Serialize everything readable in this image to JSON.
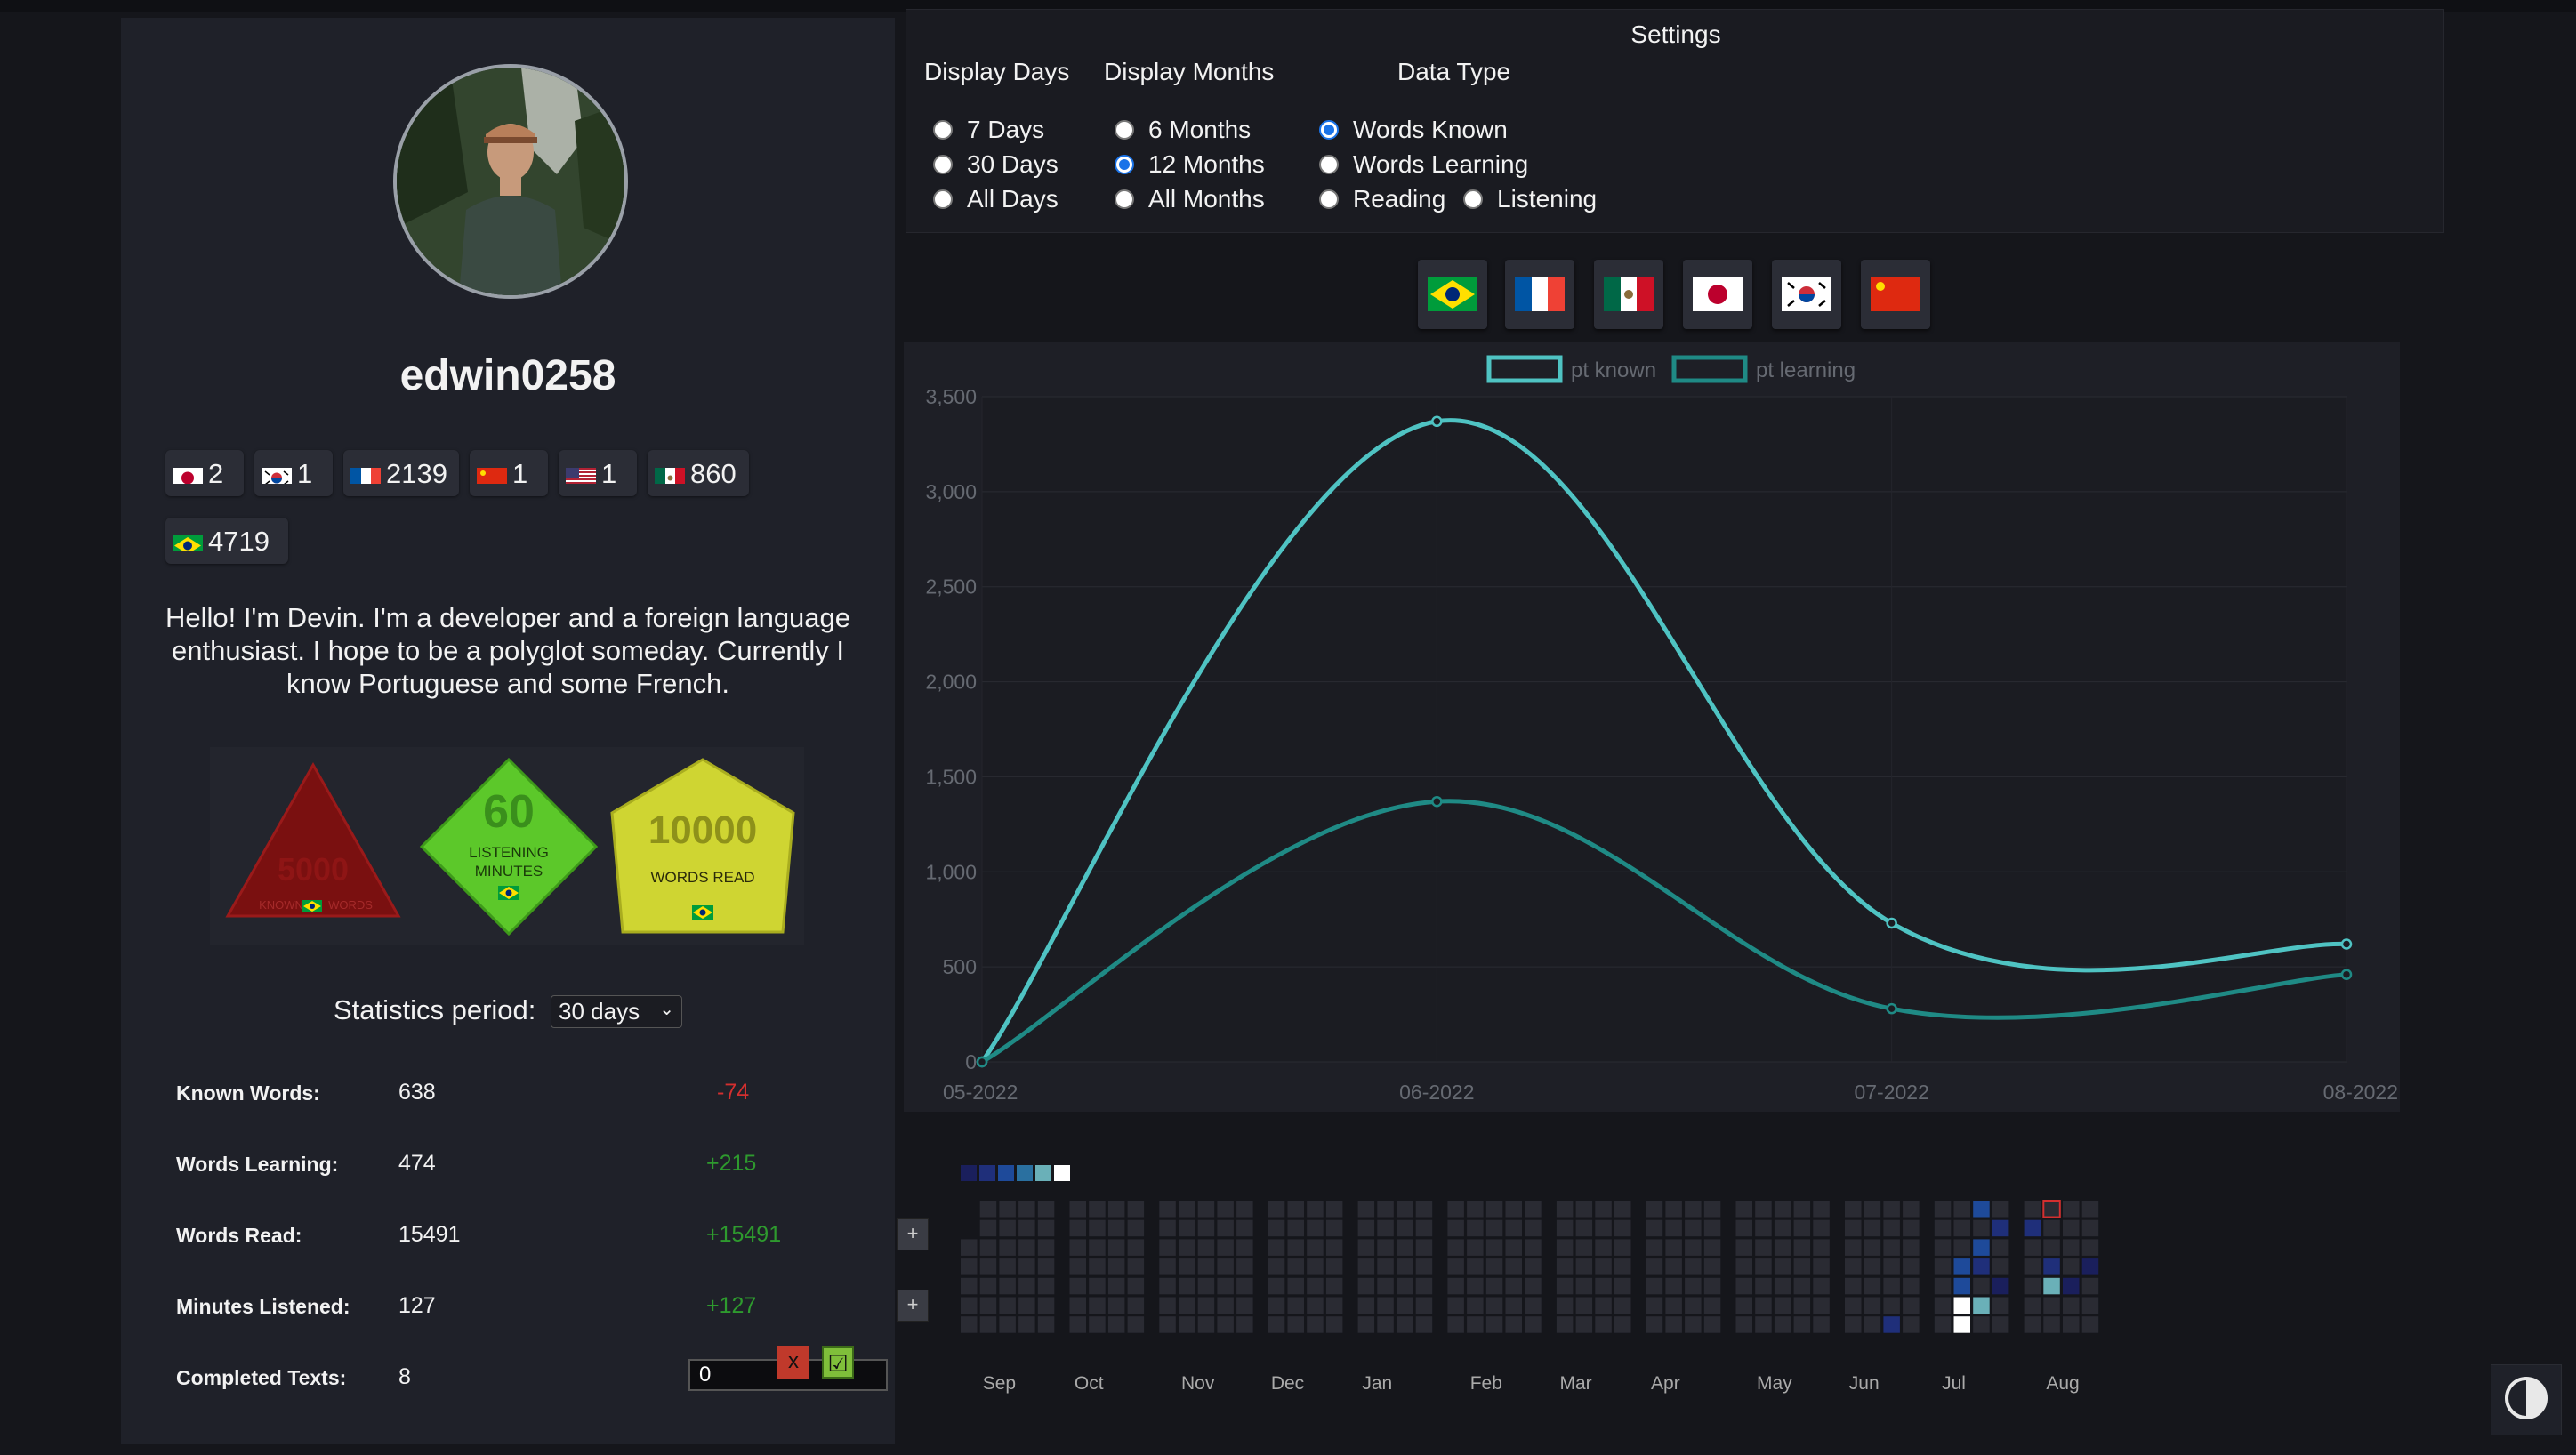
{
  "profile": {
    "username": "edwin0258",
    "bio": "Hello! I'm Devin. I'm a developer and a foreign language enthusiast. I hope to be a polyglot someday. Currently I know Portuguese and some French.",
    "languages": [
      {
        "flag": "jp",
        "count": "2"
      },
      {
        "flag": "kr",
        "count": "1"
      },
      {
        "flag": "fr",
        "count": "2139"
      },
      {
        "flag": "cn",
        "count": "1"
      },
      {
        "flag": "us",
        "count": "1"
      },
      {
        "flag": "mx",
        "count": "860"
      },
      {
        "flag": "br",
        "count": "4719"
      }
    ],
    "badges": [
      {
        "shape": "triangle",
        "value": "5000",
        "label": "KNOWN",
        "label2": "WORDS",
        "color": "#8b1010",
        "achieved": false
      },
      {
        "shape": "diamond",
        "value": "60",
        "label": "LISTENING",
        "label2": "MINUTES",
        "color": "#5ccf2b",
        "achieved": true
      },
      {
        "shape": "pentagon",
        "value": "10000",
        "label": "WORDS READ",
        "label2": "",
        "color": "#c9d12f",
        "achieved": true
      }
    ],
    "period_label": "Statistics period:",
    "period_value": "30 days",
    "stats": [
      {
        "label": "Known Words:",
        "value": "638",
        "delta": "-74",
        "delta_color": "#d32f2f",
        "control": "none"
      },
      {
        "label": "Words Learning:",
        "value": "474",
        "delta": "+215",
        "delta_color": "#2e9a2e",
        "control": "none"
      },
      {
        "label": "Words Read:",
        "value": "15491",
        "delta": "+15491",
        "delta_color": "#2e9a2e",
        "control": "plus"
      },
      {
        "label": "Minutes Listened:",
        "value": "127",
        "delta": "+127",
        "delta_color": "#2e9a2e",
        "control": "plus"
      },
      {
        "label": "Completed Texts:",
        "value": "8",
        "delta": "",
        "delta_color": "#2e9a2e",
        "control": "input"
      }
    ],
    "completed_input_value": "0",
    "plus_label": "+",
    "cancel_label": "x",
    "confirm_label": "☑"
  },
  "settings": {
    "title": "Settings",
    "display_days": {
      "title": "Display Days",
      "options": [
        "7 Days",
        "30 Days",
        "All Days"
      ],
      "selected": null
    },
    "display_months": {
      "title": "Display Months",
      "options": [
        "6 Months",
        "12 Months",
        "All Months"
      ],
      "selected": "12 Months"
    },
    "data_type": {
      "title": "Data Type",
      "options": [
        "Words Known",
        "Words Learning",
        "Reading",
        "Listening"
      ],
      "selected": "Words Known"
    }
  },
  "language_buttons": [
    "br",
    "fr",
    "mx",
    "jp",
    "kr",
    "cn"
  ],
  "chart_data": {
    "type": "line",
    "x": [
      "05-2022",
      "06-2022",
      "07-2022",
      "08-2022"
    ],
    "series": [
      {
        "name": "pt known",
        "color": "#4fc3c3",
        "values": [
          0,
          3370,
          730,
          620
        ]
      },
      {
        "name": "pt learning",
        "color": "#1f8a85",
        "values": [
          0,
          1370,
          280,
          460
        ]
      }
    ],
    "ylim": [
      0,
      3500
    ],
    "yticks": [
      "0",
      "500",
      "1,000",
      "1,500",
      "2,000",
      "2,500",
      "3,000",
      "3,500"
    ],
    "legend": "top",
    "grid": true
  },
  "heatmap": {
    "months": [
      "Sep",
      "Oct",
      "Nov",
      "Dec",
      "Jan",
      "Feb",
      "Mar",
      "Apr",
      "May",
      "Jun",
      "Jul",
      "Aug"
    ],
    "legend_colors": [
      "#1a1f5c",
      "#1f2f7a",
      "#1e4a9a",
      "#2a70a0",
      "#6ab0b8",
      "#ffffff"
    ]
  },
  "theme_toggle_icon": "contrast-icon"
}
